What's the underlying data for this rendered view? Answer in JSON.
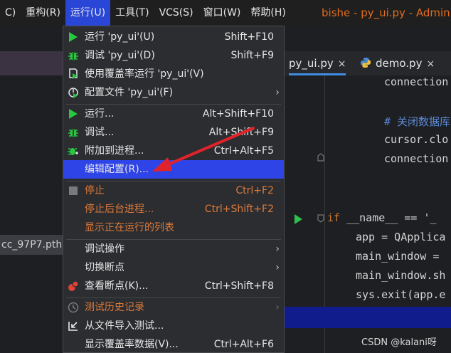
{
  "menubar": {
    "items": [
      {
        "label": "C)"
      },
      {
        "label": "重构(R)"
      },
      {
        "label": "运行(U)"
      },
      {
        "label": "工具(T)"
      },
      {
        "label": "VCS(S)"
      },
      {
        "label": "窗口(W)"
      },
      {
        "label": "帮助(H)"
      }
    ],
    "window_title": "bishe - py_ui.py - Adminis"
  },
  "left_panel": {
    "file_label": "cc_97P7.pth"
  },
  "editor": {
    "tabs": [
      {
        "label": "py_ui.py",
        "close": "×"
      },
      {
        "label": "demo.py",
        "close": "×"
      }
    ],
    "lines": [
      "connection",
      "# 关闭数据库",
      "cursor.clo",
      "connection",
      "__name__ == '_",
      "app = QApplica",
      "main_window =",
      "main_window.sh",
      "sys.exit(app.e"
    ],
    "if_keyword": "if"
  },
  "run_menu": {
    "items": [
      {
        "label": "运行 'py_ui'(U)",
        "shortcut": "Shift+F10"
      },
      {
        "label": "调试 'py_ui'(D)",
        "shortcut": "Shift+F9"
      },
      {
        "label": "使用覆盖率运行  'py_ui'(V)",
        "shortcut": ""
      },
      {
        "label": "配置文件 'py_ui'(F)",
        "submenu": "›"
      },
      {
        "label": "运行...",
        "shortcut": "Alt+Shift+F10"
      },
      {
        "label": "调试...",
        "shortcut": "Alt+Shift+F9"
      },
      {
        "label": "附加到进程...",
        "shortcut": "Ctrl+Alt+F5"
      },
      {
        "label": "编辑配置(R)...",
        "shortcut": ""
      },
      {
        "label": "停止",
        "shortcut": "Ctrl+F2"
      },
      {
        "label": "停止后台进程...",
        "shortcut": "Ctrl+Shift+F2"
      },
      {
        "label": "显示正在运行的列表",
        "shortcut": ""
      },
      {
        "label": "调试操作",
        "submenu": "›"
      },
      {
        "label": "切换断点",
        "submenu": "›"
      },
      {
        "label": "查看断点(K)...",
        "shortcut": "Ctrl+Shift+F8"
      },
      {
        "label": "测试历史记录",
        "submenu": "›"
      },
      {
        "label": "从文件导入测试...",
        "shortcut": ""
      },
      {
        "label": "显示覆盖率数据(V)...",
        "shortcut": "Ctrl+Alt+F6"
      }
    ]
  },
  "watermark": "CSDN @kalani呀",
  "colors": {
    "accent": "#2f44e6",
    "warning_text": "#e07a3a",
    "run_green": "#28c840",
    "arrow_red": "#e0232a"
  }
}
